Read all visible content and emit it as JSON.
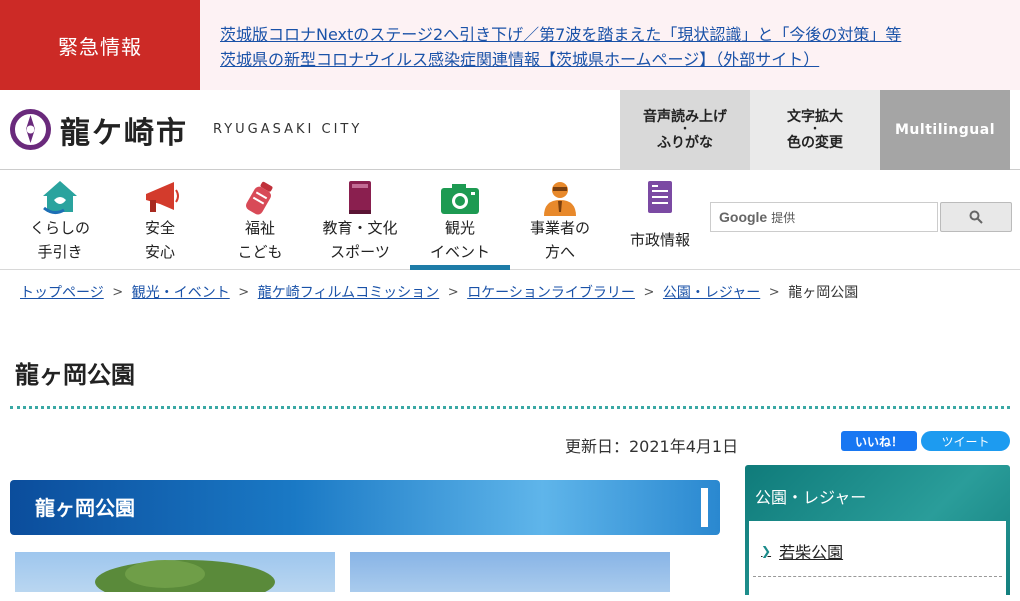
{
  "emergency": {
    "label": "緊急情報",
    "links": [
      "茨城版コロナNextのステージ2へ引き下げ／第7波を踏まえた「現状認識」と「今後の対策」等",
      "茨城県の新型コロナウイルス感染症関連情報【茨城県ホームページ】（外部サイト）"
    ]
  },
  "header": {
    "logo_ja": "龍ケ崎市",
    "logo_en": "RYUGASAKI CITY",
    "voice": {
      "line1": "音声読み上げ",
      "dot": "・",
      "line2": "ふりがな"
    },
    "text": {
      "line1": "文字拡大",
      "dot": "・",
      "line2": "色の変更"
    },
    "multilingual": "Multilingual"
  },
  "gnav": {
    "items": [
      {
        "line1": "くらしの",
        "line2": "手引き",
        "icon": "house-icon"
      },
      {
        "line1": "安全",
        "line2": "安心",
        "icon": "megaphone-icon"
      },
      {
        "line1": "福祉",
        "line2": "こども",
        "icon": "baby-bottle-icon"
      },
      {
        "line1": "教育・文化",
        "line2": "スポーツ",
        "icon": "book-icon"
      },
      {
        "line1": "観光",
        "line2": "イベント",
        "icon": "camera-icon"
      },
      {
        "line1": "事業者の",
        "line2": "方へ",
        "icon": "businessperson-icon"
      },
      {
        "line1": "市政情報",
        "line2": "",
        "icon": "document-icon"
      }
    ],
    "active_index": 4
  },
  "search": {
    "google": "Google",
    "placeholder": "提供"
  },
  "breadcrumb": {
    "links": [
      "トップページ",
      "観光・イベント",
      "龍ケ崎フィルムコミッション",
      "ロケーションライブラリー",
      "公園・レジャー"
    ],
    "current": "龍ヶ岡公園",
    "separator": ">"
  },
  "page": {
    "title": "龍ヶ岡公園",
    "updated": "更新日：2021年4月1日",
    "section_heading": "龍ヶ岡公園"
  },
  "social": {
    "facebook": "いいね！",
    "twitter": "ツイート"
  },
  "side": {
    "title": "公園・レジャー",
    "items": [
      "若柴公園"
    ]
  },
  "colors": {
    "emergency": "#cc2a26",
    "accent_teal": "#1a8b8a",
    "link": "#1a52a8",
    "nav_active": "#1e7ca8"
  }
}
